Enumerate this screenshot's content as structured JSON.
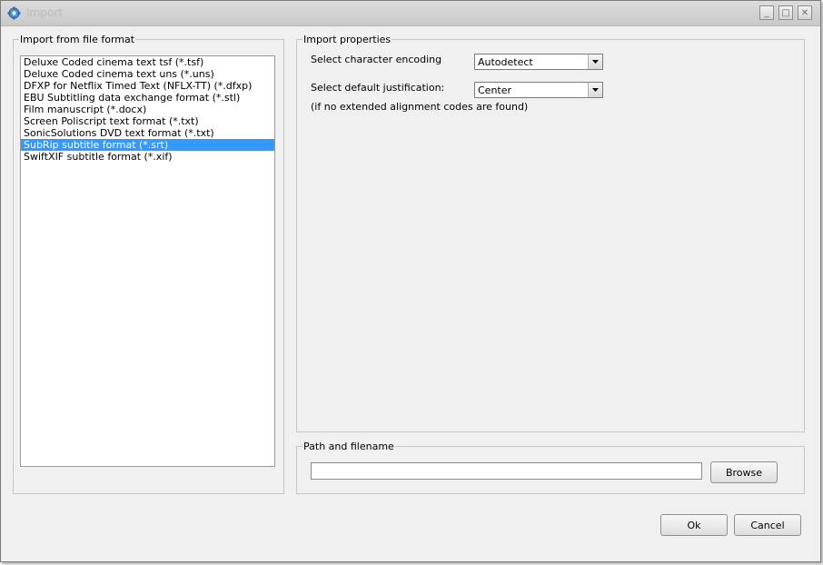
{
  "window": {
    "title": "Import",
    "controls": {
      "minimize": "_",
      "maximize": "□",
      "close": "✕"
    }
  },
  "left_panel": {
    "legend": "Import from file format",
    "formats": [
      "Deluxe Coded cinema text tsf (*.tsf)",
      "Deluxe Coded cinema text uns (*.uns)",
      "DFXP for Netflix Timed Text (NFLX-TT) (*.dfxp)",
      "EBU Subtitling data exchange format (*.stl)",
      "Film manuscript (*.docx)",
      "Screen Poliscript text format (*.txt)",
      "SonicSolutions DVD text format (*.txt)",
      "SubRip subtitle format (*.srt)",
      "SwiftXIF subtitle format (*.xif)"
    ],
    "selected_index": 7
  },
  "properties": {
    "legend": "Import properties",
    "encoding_label": "Select character encoding",
    "encoding_value": "Autodetect",
    "justification_label": "Select default justification:",
    "justification_value": "Center",
    "justification_note": "(if no extended alignment codes are found)"
  },
  "path": {
    "legend": "Path and filename",
    "value": "",
    "browse_label": "Browse"
  },
  "buttons": {
    "ok": "Ok",
    "cancel": "Cancel"
  },
  "colors": {
    "selection": "#3399ff",
    "window_bg": "#f0f0f0"
  },
  "icons": {
    "app": "gear-icon",
    "combo_arrow": "triangle-down-icon"
  }
}
